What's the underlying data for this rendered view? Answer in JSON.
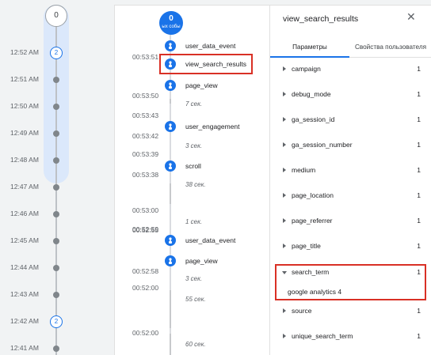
{
  "minutes": {
    "top_badge": "0",
    "rows": [
      {
        "time": "12:52 AM",
        "count": "2"
      },
      {
        "time": "12:51 AM"
      },
      {
        "time": "12:50 AM"
      },
      {
        "time": "12:49 AM"
      },
      {
        "time": "12:48 AM"
      },
      {
        "time": "12:47 AM"
      },
      {
        "time": "12:46 AM"
      },
      {
        "time": "12:45 AM"
      },
      {
        "time": "12:44 AM"
      },
      {
        "time": "12:43 AM"
      },
      {
        "time": "12:42 AM",
        "count": "2"
      },
      {
        "time": "12:41 AM"
      }
    ]
  },
  "stream": {
    "top_count": "0",
    "top_label": "ых собы",
    "events": [
      {
        "time": "00:53:51",
        "name": "user_data_event"
      },
      {
        "time": "",
        "name": "view_search_results"
      },
      {
        "time": "00:53:50",
        "name": "page_view"
      },
      {
        "time": "00:53:42",
        "name": "user_engagement"
      },
      {
        "time": "00:53:38",
        "name": "scroll"
      },
      {
        "time": "00:52:59",
        "name": "user_data_event"
      },
      {
        "time": "00:52:58",
        "name": "page_view"
      }
    ],
    "stamps": [
      "00:53:43",
      "00:53:39",
      "00:53:00",
      "00:52:55",
      "00:52:00"
    ],
    "gaps": [
      "7 сек.",
      "3 сек.",
      "38 сек.",
      "1 сек.",
      "3 сек.",
      "55 сек.",
      "60 сек."
    ]
  },
  "detail": {
    "title": "view_search_results",
    "close_icon": "close-icon",
    "tabs": [
      "Параметры",
      "Свойства пользователя"
    ],
    "params": [
      {
        "name": "campaign",
        "count": "1"
      },
      {
        "name": "debug_mode",
        "count": "1"
      },
      {
        "name": "ga_session_id",
        "count": "1"
      },
      {
        "name": "ga_session_number",
        "count": "1"
      },
      {
        "name": "medium",
        "count": "1"
      },
      {
        "name": "page_location",
        "count": "1"
      },
      {
        "name": "page_referrer",
        "count": "1"
      },
      {
        "name": "page_title",
        "count": "1"
      },
      {
        "name": "search_term",
        "count": "1"
      },
      {
        "name": "source",
        "count": "1"
      },
      {
        "name": "unique_search_term",
        "count": "1"
      }
    ],
    "expanded_value": "google analytics 4"
  },
  "colors": {
    "accent": "#1a73e8",
    "highlight": "#d93025"
  }
}
